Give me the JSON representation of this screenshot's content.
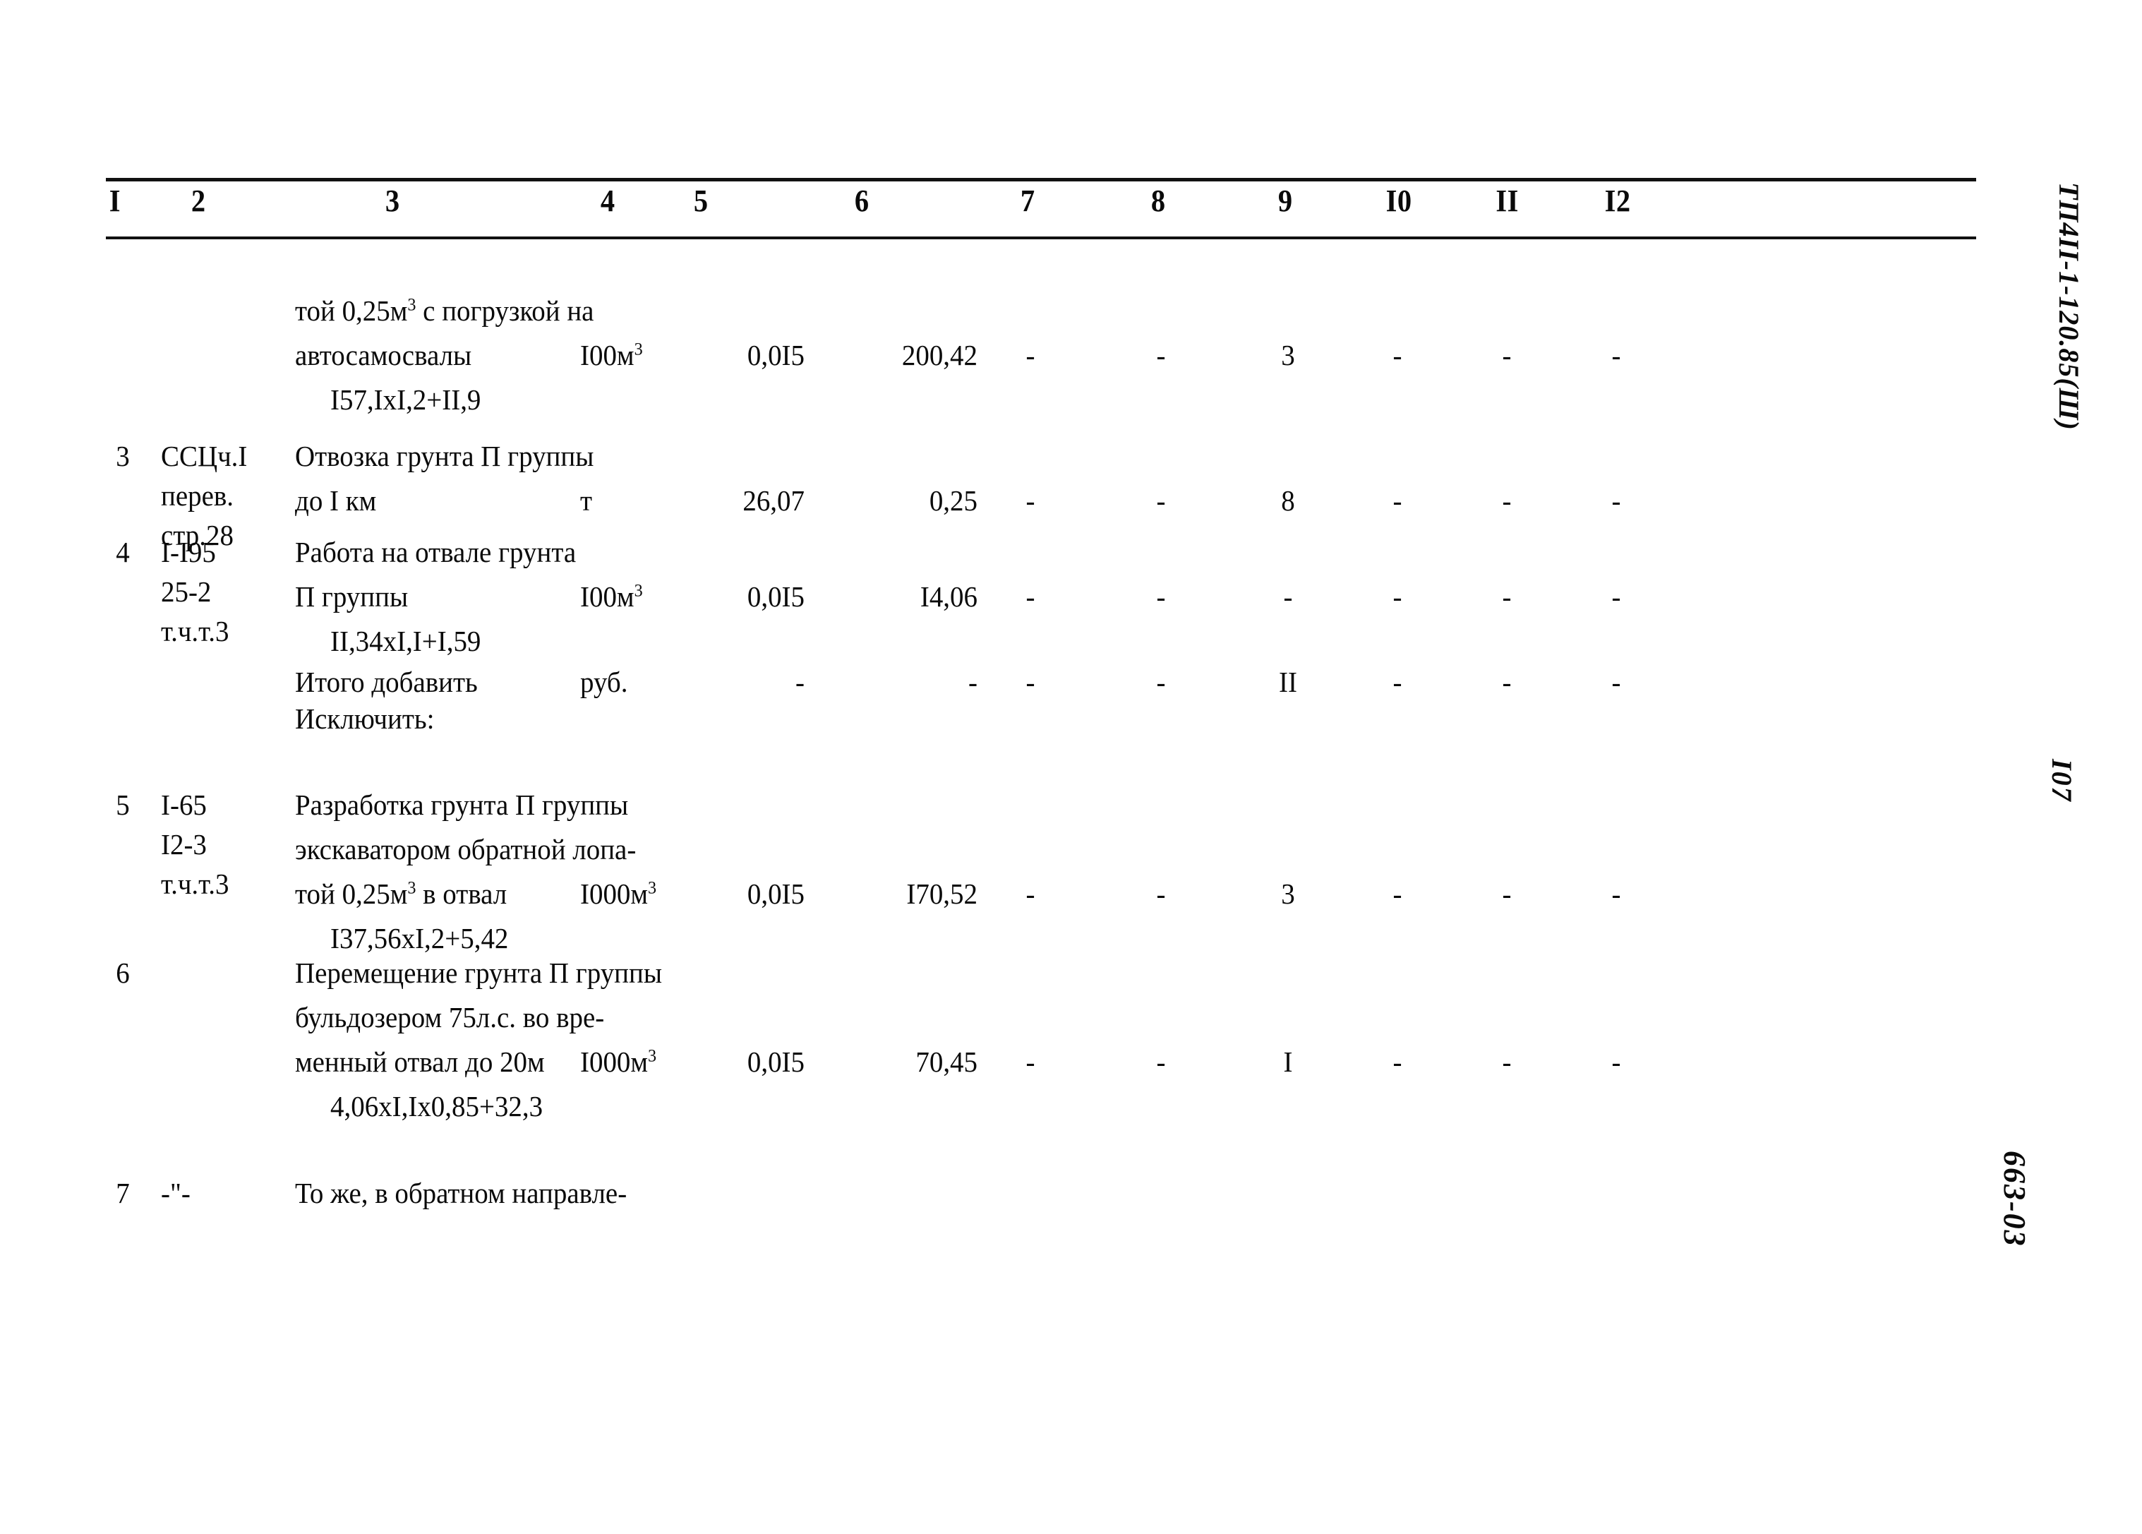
{
  "document": {
    "type": "scanned-cost-estimate-table",
    "margin_notes": {
      "code": "ТП4II-1-120.85(Ш)",
      "page_number": "I07",
      "doc_number": "663-03"
    }
  },
  "table": {
    "column_headers": [
      "I",
      "2",
      "3",
      "4",
      "5",
      "6",
      "7",
      "8",
      "9",
      "I0",
      "II",
      "I2"
    ],
    "rows": [
      {
        "id": "row-continued",
        "c1": "",
        "c2": [],
        "c3": [
          "той 0,25м<sup>3</sup> с погрузкой на",
          "автосамосвалы"
        ],
        "c3_formula": "I57,IxI,2+II,9",
        "c4": "I00м<sup>3</sup>",
        "c5": "0,0I5",
        "c6": "200,42",
        "c7": "-",
        "c8": "-",
        "c9": "3",
        "c10": "-",
        "c11": "-",
        "c12": "-"
      },
      {
        "id": "row-3",
        "c1": "3",
        "c2": [
          "ССЦч.I",
          "перев.",
          "стр.28"
        ],
        "c3": [
          "Отвозка грунта П группы",
          "до I км"
        ],
        "c3_formula": "",
        "c4": "т",
        "c5": "26,07",
        "c6": "0,25",
        "c7": "-",
        "c8": "-",
        "c9": "8",
        "c10": "-",
        "c11": "-",
        "c12": "-"
      },
      {
        "id": "row-4",
        "c1": "4",
        "c2": [
          "I-I95",
          "25-2",
          "т.ч.т.3"
        ],
        "c3": [
          "Работа на отвале грунта",
          "П группы"
        ],
        "c3_formula": "II,34xI,I+I,59",
        "c4": "I00м<sup>3</sup>",
        "c5": "0,0I5",
        "c6": "I4,06",
        "c7": "-",
        "c8": "-",
        "c9": "-",
        "c10": "-",
        "c11": "-",
        "c12": "-"
      },
      {
        "id": "row-total-add",
        "c1": "",
        "c2": [],
        "c3": [
          "Итого добавить"
        ],
        "c3_formula": "",
        "c4": "руб.",
        "c5": "-",
        "c6": "-",
        "c7": "-",
        "c8": "-",
        "c9": "II",
        "c10": "-",
        "c11": "-",
        "c12": "-"
      },
      {
        "id": "row-exclude-heading",
        "c1": "",
        "c2": [],
        "c3": [
          "Исключить:"
        ],
        "c3_formula": "",
        "c4": "",
        "c5": "",
        "c6": "",
        "c7": "",
        "c8": "",
        "c9": "",
        "c10": "",
        "c11": "",
        "c12": ""
      },
      {
        "id": "row-5",
        "c1": "5",
        "c2": [
          "I-65",
          "I2-3",
          "т.ч.т.3"
        ],
        "c3": [
          "Разработка грунта П группы",
          "экскаватором обратной лопа-",
          "той 0,25м<sup>3</sup> в отвал"
        ],
        "c3_formula": "I37,56xI,2+5,42",
        "c4": "I000м<sup>3</sup>",
        "c5": "0,0I5",
        "c6": "I70,52",
        "c7": "-",
        "c8": "-",
        "c9": "3",
        "c10": "-",
        "c11": "-",
        "c12": "-"
      },
      {
        "id": "row-6",
        "c1": "6",
        "c2": [],
        "c3": [
          "Перемещение грунта П группы",
          "бульдозером 75л.с. во вре-",
          "менный отвал до 20м"
        ],
        "c3_formula": "4,06xI,Ix0,85+32,3",
        "c4": "I000м<sup>3</sup>",
        "c5": "0,0I5",
        "c6": "70,45",
        "c7": "-",
        "c8": "-",
        "c9": "I",
        "c10": "-",
        "c11": "-",
        "c12": "-"
      },
      {
        "id": "row-7",
        "c1": "7",
        "c2": [
          "-\"-"
        ],
        "c3": [
          "То же, в обратном направле-"
        ],
        "c3_formula": "",
        "c4": "",
        "c5": "",
        "c6": "",
        "c7": "",
        "c8": "",
        "c9": "",
        "c10": "",
        "c11": "",
        "c12": ""
      }
    ]
  }
}
